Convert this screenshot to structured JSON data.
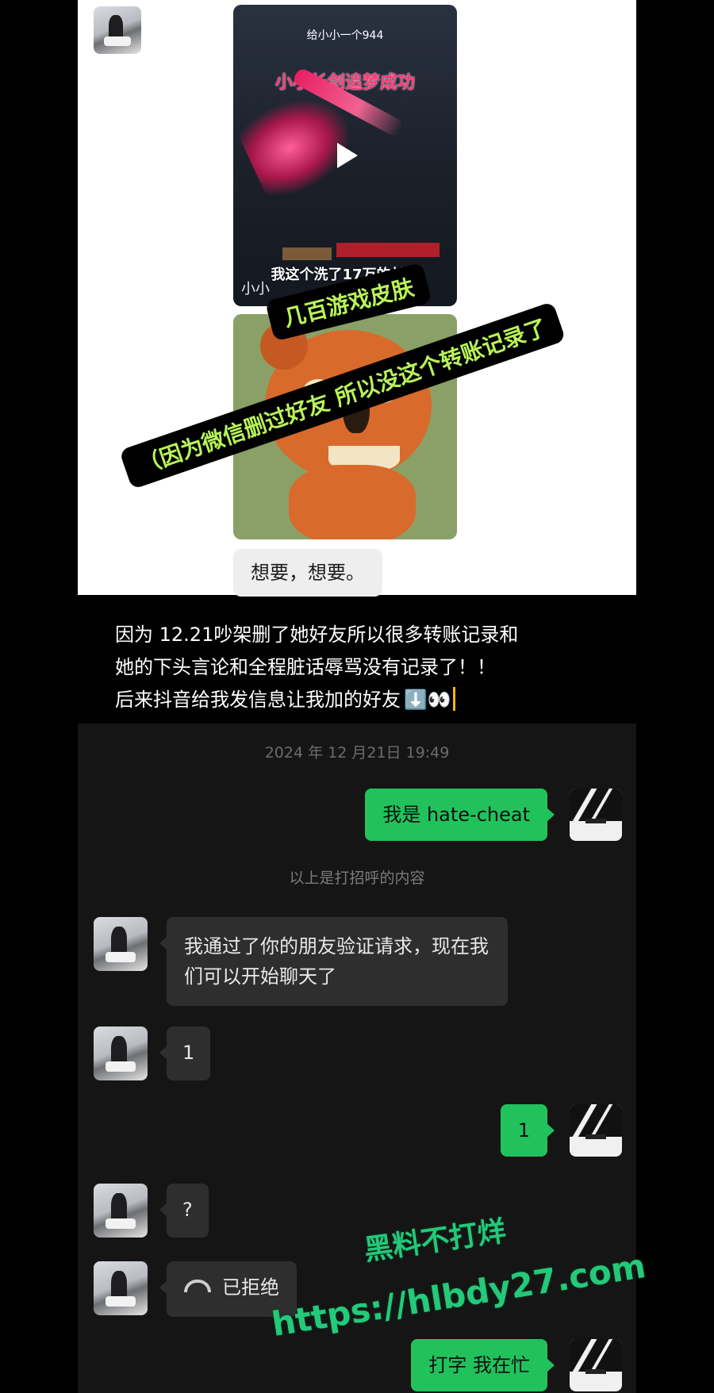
{
  "top_chat": {
    "video": {
      "header": "给小小一个944",
      "title": "小小长剑追梦成功",
      "caption": "我这个洗了17万的长剑",
      "username": "小小"
    },
    "message": "想要，想要。"
  },
  "stamps": {
    "line1": "几百游戏皮肤",
    "line2": "（因为微信删过好友 所以没这个转账记录了"
  },
  "note": {
    "line1": "因为 12.21吵架删了她好友所以很多转账记录和",
    "line2": "她的下头言论和全程脏话辱骂没有记录了！！",
    "line3": "后来抖音给我发信息让我加的好友",
    "emoji": "⬇️👀"
  },
  "dark_chat": {
    "timestamp": "2024 年 12 月21日 19:49",
    "messages": {
      "out1": "我是 hate-cheat",
      "system": "以上是打招呼的内容",
      "in1": "我通过了你的朋友验证请求，现在我们可以开始聊天了",
      "in2": "1",
      "out2": "1",
      "in3": "?",
      "in4_call": "已拒绝",
      "out3": "打字 我在忙"
    }
  },
  "watermark": {
    "line1": "黑料不打烊",
    "line2": "https://hlbdy27.com"
  }
}
